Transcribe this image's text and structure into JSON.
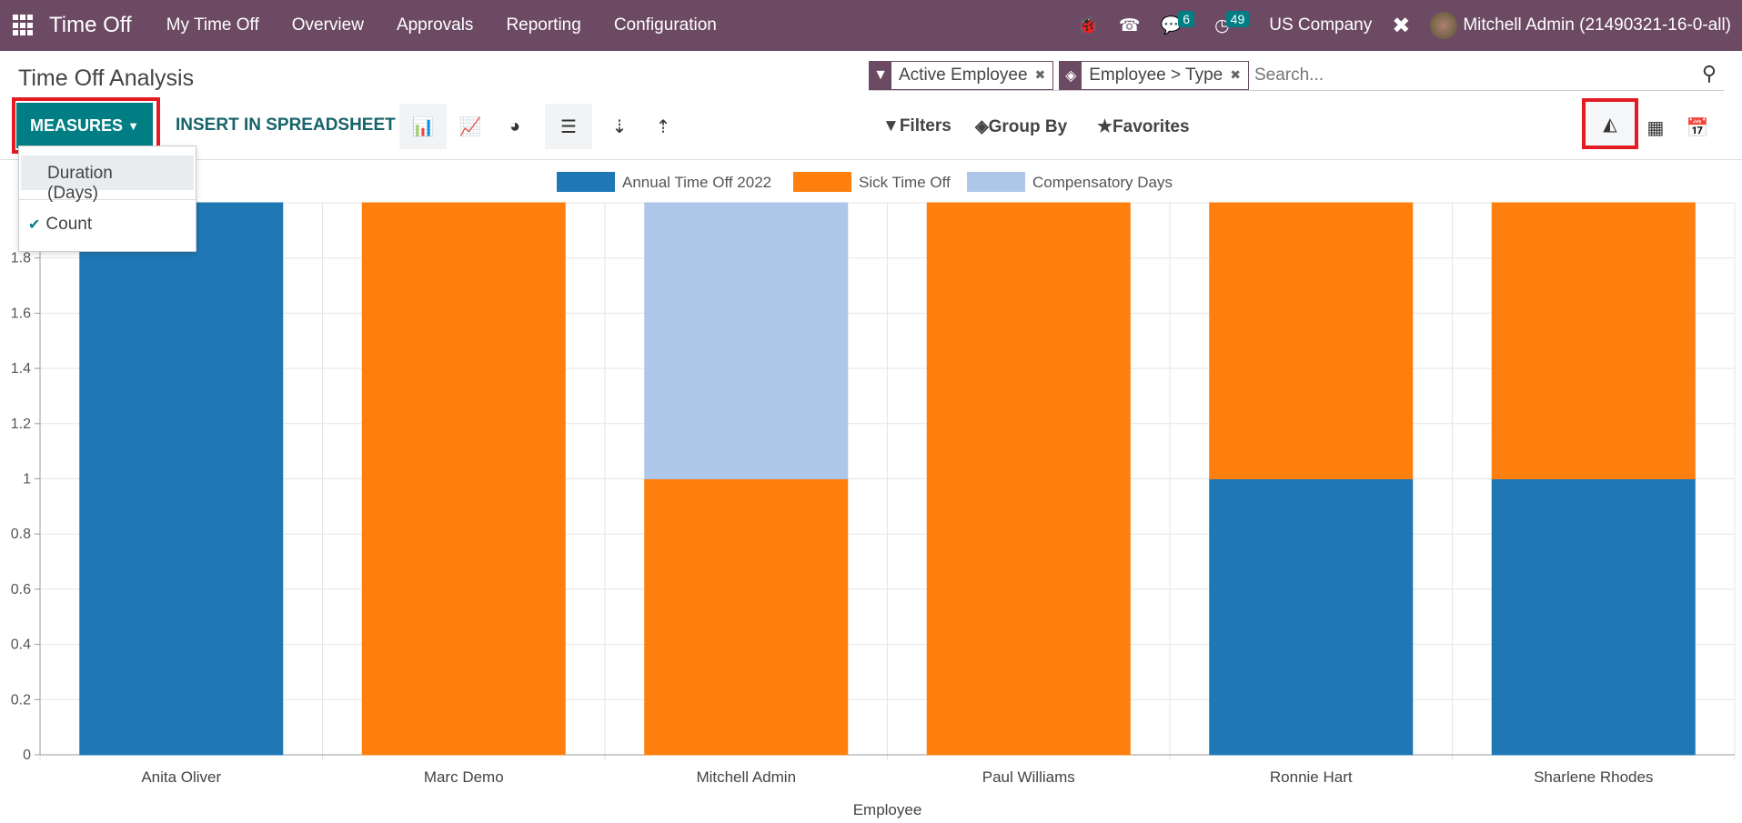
{
  "navbar": {
    "app_title": "Time Off",
    "menu": [
      "My Time Off",
      "Overview",
      "Approvals",
      "Reporting",
      "Configuration"
    ],
    "messages_count": "6",
    "activities_count": "49",
    "company": "US Company",
    "user": "Mitchell Admin (21490321-16-0-all)"
  },
  "page": {
    "title": "Time Off Analysis"
  },
  "search": {
    "facets": [
      {
        "icon": "filter-icon",
        "label": "Active Employee"
      },
      {
        "icon": "layers-icon",
        "label": "Employee > Type"
      }
    ],
    "placeholder": "Search..."
  },
  "toolbar": {
    "measures_label": "MEASURES",
    "insert_label": "INSERT IN SPREADSHEET",
    "filters": "Filters",
    "group_by": "Group By",
    "favorites": "Favorites",
    "active_chart": "bar",
    "active_view": "graph"
  },
  "measures_menu": {
    "items": [
      {
        "label": "Duration (Days)",
        "checked": false
      },
      {
        "label": "Count",
        "checked": true
      }
    ]
  },
  "chart_data": {
    "type": "bar",
    "stacked": true,
    "categories": [
      "Anita Oliver",
      "Marc Demo",
      "Mitchell Admin",
      "Paul Williams",
      "Ronnie Hart",
      "Sharlene Rhodes"
    ],
    "series": [
      {
        "name": "Annual Time Off 2022",
        "color": "#1f77b4",
        "values": [
          2,
          0,
          0,
          0,
          1,
          1
        ]
      },
      {
        "name": "Sick Time Off",
        "color": "#ff7f0e",
        "values": [
          0,
          2,
          1,
          2,
          1,
          1
        ]
      },
      {
        "name": "Compensatory Days",
        "color": "#aec7e8",
        "values": [
          0,
          0,
          1,
          0,
          0,
          0
        ]
      }
    ],
    "xlabel": "Employee",
    "ylabel": "",
    "ylim": [
      0,
      2
    ],
    "yticks": [
      "0",
      "0.2",
      "0.4",
      "0.6",
      "0.8",
      "1",
      "1.2",
      "1.4",
      "1.6",
      "1.8"
    ],
    "grid": true,
    "legend": "top"
  }
}
